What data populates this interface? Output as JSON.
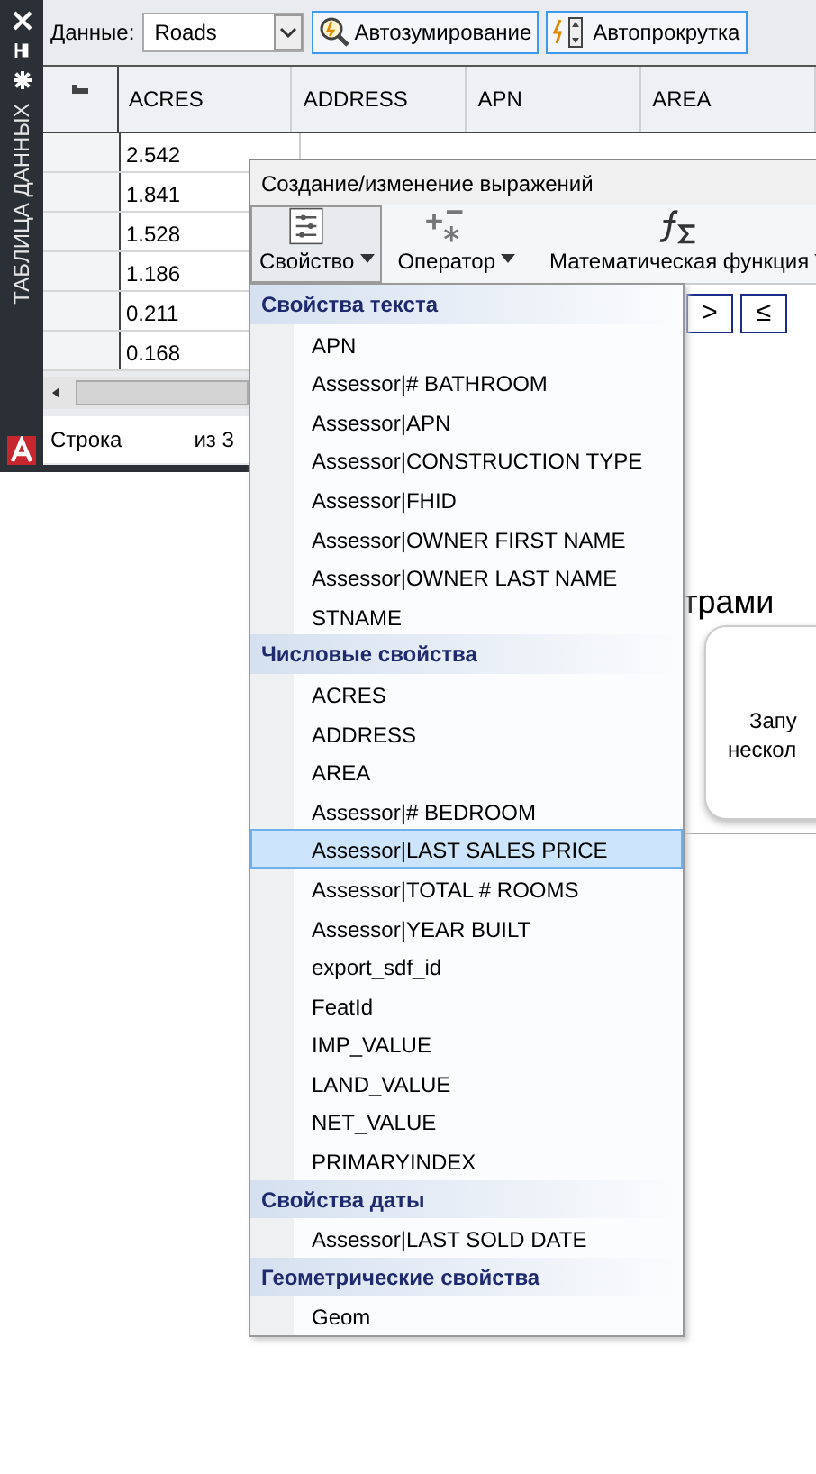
{
  "palette": {
    "title": "ТАБЛИЦА ДАННЫХ"
  },
  "toolbar": {
    "data_label": "Данные:",
    "data_value": "Roads",
    "buttons": [
      {
        "label": "Автозумирование",
        "kind": "zoom"
      },
      {
        "label": "Автопрокрутка",
        "kind": "scroll"
      }
    ]
  },
  "table": {
    "columns": [
      "ACRES",
      "ADDRESS",
      "APN",
      "AREA"
    ],
    "rows": [
      [
        "2.542"
      ],
      [
        "1.841"
      ],
      [
        "1.528"
      ],
      [
        "1.186"
      ],
      [
        "0.211"
      ],
      [
        "0.168"
      ]
    ]
  },
  "status_bar": {
    "row_label": "Строка",
    "of_label": "из 3"
  },
  "dialog": {
    "title": "Создание/изменение выражений",
    "ribbon": [
      {
        "label": "Свойство",
        "kind": "property",
        "selected": true
      },
      {
        "label": "Оператор",
        "kind": "operator",
        "selected": false
      },
      {
        "label": "Математическая функция",
        "kind": "math",
        "selected": false
      }
    ],
    "operators": [
      ">",
      "≤"
    ],
    "side_heading": "трами",
    "side_text": [
      "Запу",
      "нескол"
    ]
  },
  "menu": {
    "groups": [
      {
        "title": "Свойства текста",
        "items": [
          {
            "label": "APN",
            "selected": false
          },
          {
            "label": "Assessor|# BATHROOM",
            "selected": false
          },
          {
            "label": "Assessor|APN",
            "selected": false
          },
          {
            "label": "Assessor|CONSTRUCTION TYPE",
            "selected": false
          },
          {
            "label": "Assessor|FHID",
            "selected": false
          },
          {
            "label": "Assessor|OWNER FIRST NAME",
            "selected": false
          },
          {
            "label": "Assessor|OWNER LAST NAME",
            "selected": false
          },
          {
            "label": "STNAME",
            "selected": false
          }
        ]
      },
      {
        "title": "Числовые свойства",
        "items": [
          {
            "label": "ACRES",
            "selected": false
          },
          {
            "label": "ADDRESS",
            "selected": false
          },
          {
            "label": "AREA",
            "selected": false
          },
          {
            "label": "Assessor|# BEDROOM",
            "selected": false
          },
          {
            "label": "Assessor|LAST SALES PRICE",
            "selected": true
          },
          {
            "label": "Assessor|TOTAL # ROOMS",
            "selected": false
          },
          {
            "label": "Assessor|YEAR BUILT",
            "selected": false
          },
          {
            "label": "export_sdf_id",
            "selected": false
          },
          {
            "label": "FeatId",
            "selected": false
          },
          {
            "label": "IMP_VALUE",
            "selected": false
          },
          {
            "label": "LAND_VALUE",
            "selected": false
          },
          {
            "label": "NET_VALUE",
            "selected": false
          },
          {
            "label": "PRIMARYINDEX",
            "selected": false
          }
        ]
      },
      {
        "title": "Свойства даты",
        "items": [
          {
            "label": "Assessor|LAST SOLD DATE",
            "selected": false
          }
        ]
      },
      {
        "title": "Геометрические свойства",
        "items": [
          {
            "label": "Geom",
            "selected": false
          }
        ]
      }
    ]
  }
}
